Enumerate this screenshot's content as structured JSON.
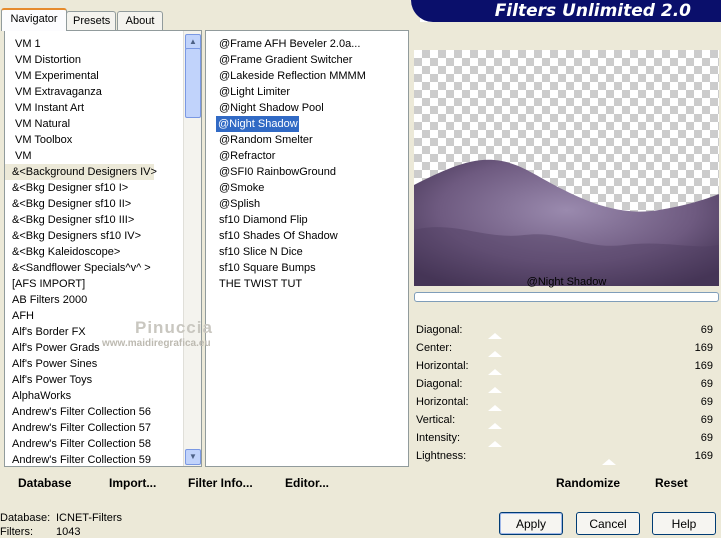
{
  "brand": "Filters Unlimited 2.0",
  "tabs": [
    "Navigator",
    "Presets",
    "About"
  ],
  "categories": [
    "VM 1",
    "VM Distortion",
    "VM Experimental",
    "VM Extravaganza",
    "VM Instant Art",
    "VM Natural",
    "VM Toolbox",
    "VM",
    "&<Background Designers IV>",
    "&<Bkg Designer sf10 I>",
    "&<Bkg Designer sf10 II>",
    "&<Bkg Designer sf10 III>",
    "&<Bkg Designers sf10 IV>",
    "&<Bkg Kaleidoscope>",
    "&<Sandflower Specials^v^ >",
    "[AFS IMPORT]",
    "AB Filters 2000",
    "AFH",
    "Alf's Border FX",
    "Alf's Power Grads",
    "Alf's Power Sines",
    "Alf's Power Toys",
    "AlphaWorks",
    "Andrew's Filter Collection 56",
    "Andrew's Filter Collection 57",
    "Andrew's Filter Collection 58",
    "Andrew's Filter Collection 59"
  ],
  "selected_category": "&<Background Designers IV>",
  "filters": [
    "@Frame AFH Beveler 2.0a...",
    "@Frame Gradient Switcher",
    "@Lakeside Reflection MMMM",
    "@Light Limiter",
    "@Night Shadow Pool",
    "@Night Shadow",
    "@Random Smelter",
    "@Refractor",
    "@SFI0 RainbowGround",
    "@Smoke",
    "@Splish",
    "sf10 Diamond Flip",
    "sf10 Shades Of Shadow",
    "sf10 Slice N Dice",
    "sf10 Square Bumps",
    "THE TWIST TUT"
  ],
  "selected_filter": "@Night Shadow",
  "filter_title": "@Night Shadow",
  "params": [
    {
      "label": "Diagonal:",
      "value": "69"
    },
    {
      "label": "Center:",
      "value": "169"
    },
    {
      "label": "Horizontal:",
      "value": "169"
    },
    {
      "label": "Diagonal:",
      "value": "69"
    },
    {
      "label": "Horizontal:",
      "value": "69"
    },
    {
      "label": "Vertical:",
      "value": "69"
    },
    {
      "label": "Intensity:",
      "value": "69"
    },
    {
      "label": "Lightness:",
      "value": "169"
    }
  ],
  "watermark": {
    "line1": "Pinuccia",
    "line2": "www.maidiregrafica.eu"
  },
  "actions": {
    "database": "Database",
    "import": "Import...",
    "filter_info": "Filter Info...",
    "editor": "Editor...",
    "randomize": "Randomize",
    "reset": "Reset"
  },
  "status": {
    "database_label": "Database:",
    "database_value": "ICNET-Filters",
    "filters_label": "Filters:",
    "filters_value": "1043"
  },
  "buttons": {
    "apply": "Apply",
    "cancel": "Cancel",
    "help": "Help"
  },
  "colors": {
    "brand_bg": "#0a0f6b",
    "selection": "#316ac5",
    "preview_shape": "#6e5a80"
  }
}
